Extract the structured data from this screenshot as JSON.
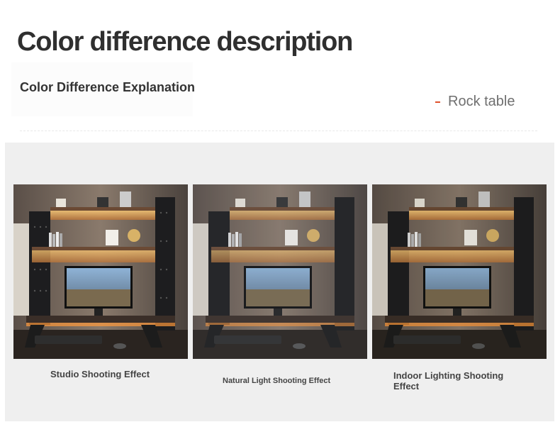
{
  "header": {
    "title": "Color difference description",
    "subtitle": "Color Difference Explanation",
    "material_label": "Rock table"
  },
  "colors": {
    "accent_dash": "#e0522c",
    "panel_bg": "#efefef",
    "led_glow": "#ffb347"
  },
  "gallery": {
    "items": [
      {
        "caption": "Studio Shooting Effect",
        "image": "desk-shelf-photo"
      },
      {
        "caption": "Natural Light Shooting Effect",
        "image": "desk-shelf-photo"
      },
      {
        "caption": "Indoor Lighting Shooting Effect",
        "image": "desk-shelf-photo"
      }
    ]
  }
}
